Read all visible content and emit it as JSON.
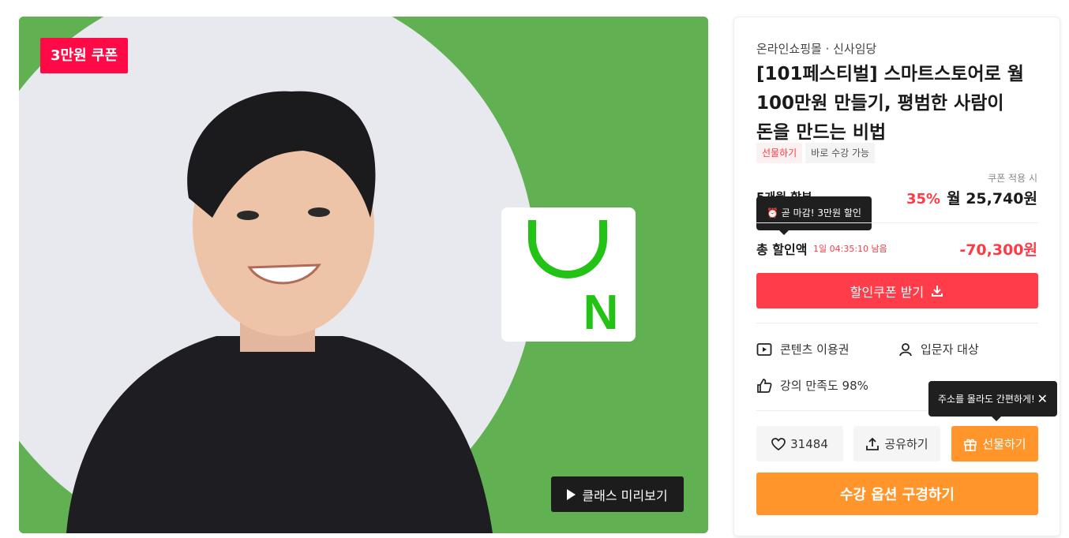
{
  "hero": {
    "coupon_badge": "3만원 쿠폰",
    "preview_button": "클래스 미리보기",
    "logo_letter": "N",
    "colors": {
      "background": "#61b152",
      "circle": "#e8e9ee",
      "logo_green": "#22c314"
    }
  },
  "product": {
    "category": "온라인쇼핑몰 · 신사임당",
    "title_lines": [
      "[101페스티벌] 스마트스토어로 월",
      "100만원 만들기, 평범한 사람이",
      "돈을 만드는 비법"
    ],
    "tags": [
      "선물하기",
      "바로 수강 가능"
    ],
    "coupon_apply_note": "쿠폰 적용 시",
    "installment_label": "5개월 할부",
    "discount_percent": "35%",
    "monthly_price": "월 25,740원",
    "deadline_tooltip": "⏰ 곧 마감! 3만원 할인",
    "total_discount_label": "총 할인액",
    "countdown": "1일 04:35:10 남음",
    "total_discount_value": "-70,300원",
    "coupon_button": "할인쿠폰 받기"
  },
  "features": {
    "content": "콘텐츠 이용권",
    "level": "입문자 대상",
    "satisfaction": "강의 만족도 98%"
  },
  "actions": {
    "address_tooltip": "주소를 몰라도 간편하게!",
    "like_count": "31484",
    "share_label": "공유하기",
    "gift_label": "선물하기",
    "buy_label": "수강 옵션 구경하기"
  },
  "colors": {
    "accent_red": "#ff3d4a",
    "accent_orange": "#ff952b",
    "badge_red": "#ff0a46"
  }
}
